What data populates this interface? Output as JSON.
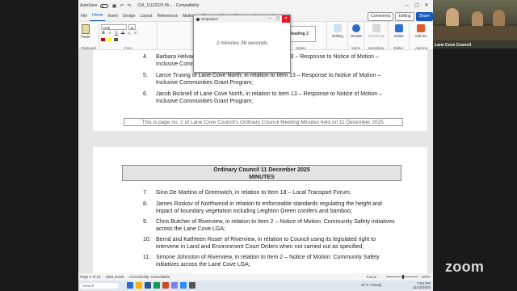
{
  "titlebar": {
    "autosave": "AutoSave",
    "autosave_state": "Off",
    "filename": "CM_11122025 Mi... · Compatibility"
  },
  "ribbon": {
    "tabs": [
      "File",
      "Home",
      "Insert",
      "Design",
      "Layout",
      "References",
      "Mailings",
      "Review",
      "View",
      "Manager",
      "Infocouncil"
    ],
    "active_tab": "Home",
    "comments_label": "Comments",
    "editing_label": "Editing",
    "share_label": "Share",
    "font_name": "Arial",
    "font_size": "11",
    "style_name": "Heading 2",
    "clipboard_group": "Clipboard",
    "font_group": "Font",
    "paragraph_group": "Paragraph",
    "styles_group": "Styles",
    "voice_group": "Voice",
    "sensitivity_group": "Sensitivity",
    "editor_group": "Editor",
    "addins_group": "Add-ins",
    "paste_label": "Paste",
    "buttons": {
      "editing": "Editing",
      "dictate": "Dictate",
      "sensitivity": "Sensitivity",
      "editor": "Editor",
      "addins": "Add-ins"
    }
  },
  "popup": {
    "title": "Stopwatch",
    "time": "2 minutes 36 seconds"
  },
  "page1": {
    "items": [
      {
        "num": "4.",
        "text": "Barbara Helvadjian of Lane Cove, in relation to Item 13 – Response to Notice of Motion – Inclusive Communities Grant Program;"
      },
      {
        "num": "5.",
        "text": "Lance Truong of Lane Cove North, in relation to Item 13 – Response to Notice of Motion – Inclusive Communities Grant Program;"
      },
      {
        "num": "6.",
        "text": "Jacob Bicknell of Lane Cove North, in relation to Item 13 – Response to Notice of Motion – Inclusive Communities Grant Program;"
      }
    ],
    "footer": "This is page no. 2 of Lane Cove Council's Ordinary Council Meeting Minutes held on 11 December 2025."
  },
  "page2": {
    "header_line1": "Ordinary Council 11 December 2025",
    "header_line2": "MINUTES",
    "items": [
      {
        "num": "7.",
        "text": "Gino De Martino of Greenwich, in relation to Item 18 – Local Transport Forum;"
      },
      {
        "num": "8.",
        "text": "James Roskov of Northwood in relation to enforceable standards regulating the height and impact of boundary vegetation including Leighton Green conifers and bamboo;"
      },
      {
        "num": "9.",
        "text": "Chris Butcher of Riverview, in relation to Item 2 – Notice of Motion: Community Safety initiatives across the Lane Cove LGA;"
      },
      {
        "num": "10.",
        "text": "Bernd and Kathleen Ruser of Riverview, in relation to Council using its legislated right to intervene in Land and Environment Court Orders when not carried out as specified;"
      },
      {
        "num": "11.",
        "text": "Simone Johnston of Riverview, in relation to Item 2 – Notice of Motion: Community Safety initiatives across the Lane Cove LGA;"
      }
    ]
  },
  "statusbar": {
    "page": "Page 2 of 13",
    "words": "4084 words",
    "accessibility": "Accessibility: Unavailable",
    "focus": "Focus",
    "zoom": "100%"
  },
  "taskbar": {
    "search": "Search",
    "weather": "21°C  Cloudy",
    "time": "7:04 PM",
    "date": "11/12/2025"
  },
  "video": {
    "participant_label": "Lane Cove Council",
    "app_logo": "zoom"
  }
}
